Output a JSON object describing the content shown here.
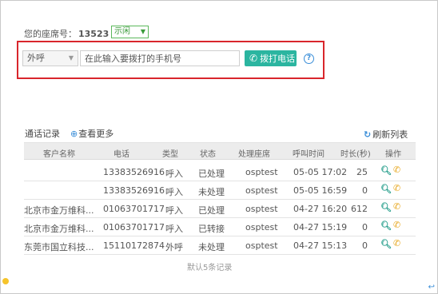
{
  "agent": {
    "seat_label": "您的座席号：",
    "seat_number": "13523",
    "status_value": "示闲"
  },
  "dial": {
    "call_type": "外呼",
    "input_placeholder": "在此输入要拨打的手机号",
    "dial_button": "拨打电话",
    "help_icon": "?"
  },
  "records": {
    "title": "通话记录",
    "view_more": "查看更多",
    "refresh": "刷新列表",
    "columns": [
      "客户名称",
      "电话",
      "类型",
      "状态",
      "处理座席",
      "呼叫时间",
      "时长(秒)",
      "操作"
    ],
    "rows": [
      {
        "customer": "",
        "phone": "13383526916",
        "type": "呼入",
        "status": "已处理",
        "agent": "osptest",
        "time": "05-05 17:02",
        "duration": "25"
      },
      {
        "customer": "",
        "phone": "13383526916",
        "type": "呼入",
        "status": "未处理",
        "agent": "osptest",
        "time": "05-05 16:59",
        "duration": "0"
      },
      {
        "customer": "北京市金万维科...",
        "phone": "01063701717",
        "type": "呼入",
        "status": "已处理",
        "agent": "osptest",
        "time": "04-27 16:20",
        "duration": "612"
      },
      {
        "customer": "北京市金万维科...",
        "phone": "01063701717",
        "type": "呼入",
        "status": "已转接",
        "agent": "osptest",
        "time": "04-27 15:19",
        "duration": "0"
      },
      {
        "customer": "东莞市国立科技...",
        "phone": "15110172874",
        "type": "外呼",
        "status": "未处理",
        "agent": "osptest",
        "time": "04-27 15:13",
        "duration": "0"
      }
    ],
    "footer": "默认5条记录"
  },
  "colors": {
    "accent": "#2bb5a0",
    "highlight_box": "#d9262c",
    "link_blue": "#3a8ed8",
    "call_icon": "#e6a417"
  }
}
